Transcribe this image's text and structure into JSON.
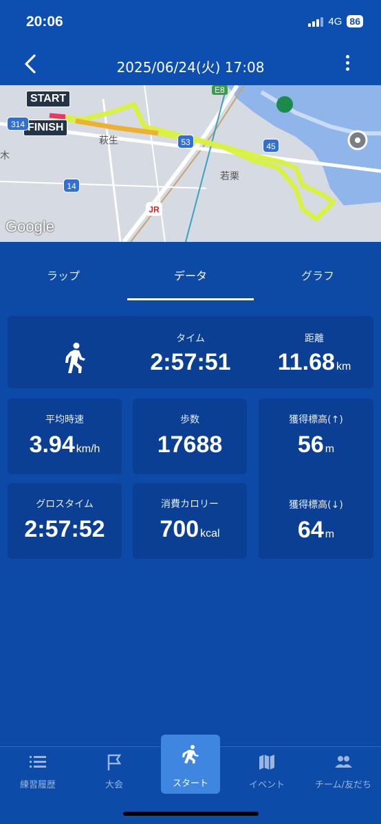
{
  "status_bar": {
    "time": "20:06",
    "network": "4G",
    "battery": "86"
  },
  "header": {
    "title": "2025/06/24(火) 17:08"
  },
  "map": {
    "start_label": "START",
    "finish_label": "FINISH",
    "attribution": "Google",
    "places": [
      "萩生",
      "若栗",
      "木"
    ],
    "road_badges": [
      "314",
      "53",
      "45",
      "14"
    ],
    "route_badge": "E8",
    "jr_label": "JR"
  },
  "tabs": [
    {
      "label": "ラップ",
      "active": false
    },
    {
      "label": "データ",
      "active": true
    },
    {
      "label": "グラフ",
      "active": false
    }
  ],
  "stats": {
    "time": {
      "label": "タイム",
      "value": "2:57:51"
    },
    "distance": {
      "label": "距離",
      "value": "11.68",
      "unit": "km"
    },
    "avg_speed": {
      "label": "平均時速",
      "value": "3.94",
      "unit": "km/h"
    },
    "steps": {
      "label": "歩数",
      "value": "17688"
    },
    "elev_gain": {
      "label": "獲得標高(↑)",
      "value": "56",
      "unit": "m"
    },
    "gross_time": {
      "label": "グロスタイム",
      "value": "2:57:52"
    },
    "calories": {
      "label": "消費カロリー",
      "value": "700",
      "unit": "kcal"
    },
    "elev_loss": {
      "label": "獲得標高(↓)",
      "value": "64",
      "unit": "m"
    }
  },
  "bottom_nav": [
    {
      "label": "練習履歴",
      "icon": "list-icon"
    },
    {
      "label": "大会",
      "icon": "flag-icon"
    },
    {
      "label": "スタート",
      "icon": "runner-icon"
    },
    {
      "label": "イベント",
      "icon": "map-icon"
    },
    {
      "label": "チーム/友だち",
      "icon": "people-icon"
    }
  ],
  "colors": {
    "header_bg": "#0d4fb0",
    "body_bg": "#0d4aa8",
    "card_bg": "#0a3f93",
    "active_nav": "#3f86e0"
  }
}
